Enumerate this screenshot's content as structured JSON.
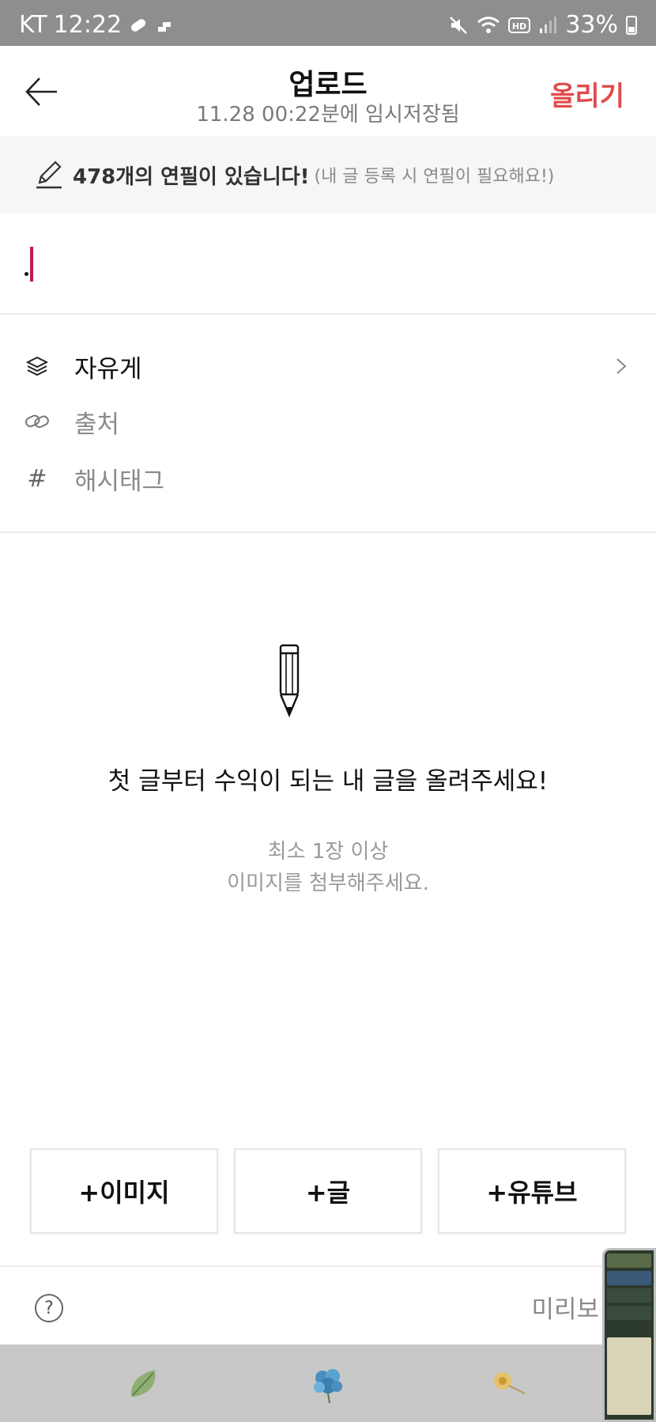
{
  "status_bar": {
    "carrier": "KT",
    "time": "12:22",
    "battery": "33%",
    "icons": [
      "pill-icon",
      "notification-icon",
      "mute-icon",
      "wifi-icon",
      "hd-icon",
      "signal-icon",
      "battery-icon"
    ]
  },
  "header": {
    "title": "업로드",
    "subtitle": "11.28 00:22분에 임시저장됨",
    "upload_label": "올리기",
    "accent_color": "#e24b4b"
  },
  "notice": {
    "main": "478개의 연필이 있습니다!",
    "sub": "(내 글 등록 시 연필이 필요해요!)"
  },
  "title_input": {
    "value": ""
  },
  "meta": {
    "board": "자유게",
    "source": "출처",
    "hashtag": "해시태그",
    "hashtag_symbol": "#"
  },
  "empty_state": {
    "title": "첫 글부터 수익이 되는 내 글을 올려주세요!",
    "line1": "최소 1장 이상",
    "line2": "이미지를 첨부해주세요."
  },
  "add_buttons": {
    "image": "+이미지",
    "text": "+글",
    "youtube": "+유튜브"
  },
  "bottom": {
    "help": "?",
    "preview": "미리보"
  }
}
